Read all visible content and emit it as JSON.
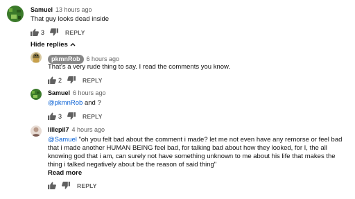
{
  "comments": [
    {
      "author": "Samuel",
      "time": "13 hours ago",
      "text": "That guy looks dead inside",
      "likes": "3",
      "reply_label": "REPLY",
      "avatar_color": "#3b7a2a"
    }
  ],
  "hide_replies_label": "Hide replies",
  "replies": [
    {
      "author": "pkmnRob",
      "time": "6 hours ago",
      "text": "That's a very rude thing to say. I read the comments you know.",
      "likes": "2",
      "reply_label": "REPLY",
      "avatar_color": "#7a6a3a"
    },
    {
      "author": "Samuel",
      "time": "6 hours ago",
      "mention": "@pkmnRob",
      "text": " and ?",
      "likes": "3",
      "reply_label": "REPLY",
      "avatar_color": "#3b7a2a"
    },
    {
      "author": "lillepil7",
      "time": "4 hours ago",
      "mention": "@Samuel",
      "text": " \"oh you felt bad about the comment i made? let me not even have any remorse or feel bad that i made another HUMAN BEING feel bad, for talking bad about how they looked, for I, the all knowing god that i am, can surely not have something unknown to me about his life that makes the thing i talked negatively about be the reason of said thing\"",
      "read_more": "Read more",
      "reply_label": "REPLY",
      "avatar_color": "#b89a8a"
    }
  ]
}
